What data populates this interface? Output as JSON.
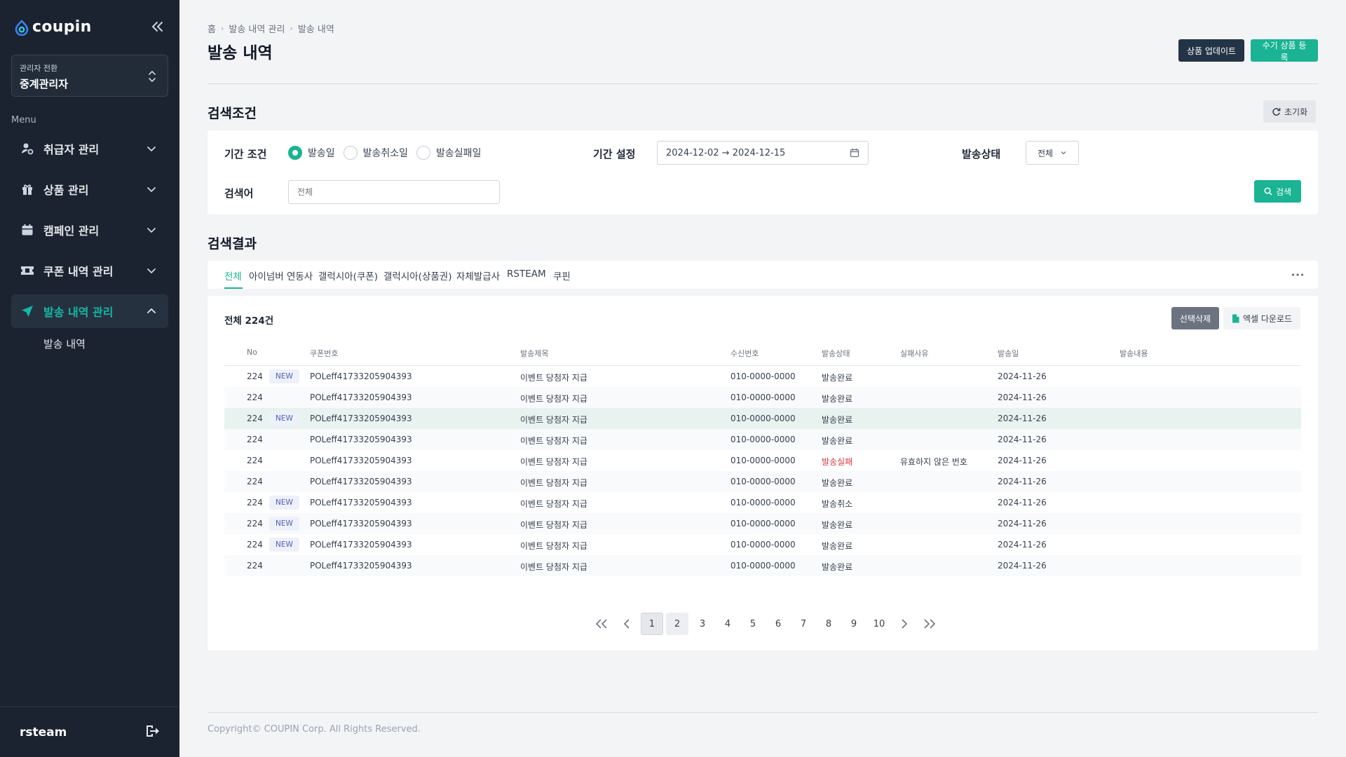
{
  "brand": {
    "name": "coupin",
    "accent": "#1ab394",
    "sidebar_bg": "#1b2330"
  },
  "sidebar": {
    "switcher": {
      "label": "관리자 전환",
      "value": "중계관리자"
    },
    "menu_caption": "Menu",
    "items": [
      {
        "label": "취급자 관리",
        "icon": "user-gear-icon"
      },
      {
        "label": "상품 관리",
        "icon": "gift-icon"
      },
      {
        "label": "캠페인 관리",
        "icon": "calendar-icon"
      },
      {
        "label": "쿠폰 내역 관리",
        "icon": "ticket-icon"
      },
      {
        "label": "발송 내역 관리",
        "icon": "send-icon",
        "active": true
      }
    ],
    "sub_item": "발송 내역",
    "user": "rsteam"
  },
  "header": {
    "breadcrumb": [
      "홈",
      "발송 내역 관리",
      "발송 내역"
    ],
    "title": "발송 내역",
    "update_button": "상품 업데이트",
    "register_button": "수기 상품 등록"
  },
  "search": {
    "title": "검색조건",
    "reset_button": "초기화",
    "period_condition_label": "기간 조건",
    "radios": [
      {
        "label": "발송일",
        "checked": true
      },
      {
        "label": "발송취소일",
        "checked": false
      },
      {
        "label": "발송실패일",
        "checked": false
      }
    ],
    "period_label": "기간 설정",
    "period_value": "2024-12-02 → 2024-12-15",
    "status_label": "발송상태",
    "status_value": "전체",
    "keyword_label": "검색어",
    "keyword_placeholder": "전체",
    "search_button": "검색"
  },
  "results": {
    "title": "검색결과",
    "tabs": [
      "전체",
      "아이넘버 연동사",
      "갤럭시아(쿠폰)",
      "갤럭시아(상품권)",
      "자체발급사",
      "RSTEAM",
      "쿠핀"
    ],
    "active_tab": "전체",
    "total": "전체 224건",
    "delete_button": "선택삭제",
    "excel_button": "엑셀 다운로드",
    "columns": [
      "No",
      "쿠폰번호",
      "발송제목",
      "수신번호",
      "발송상태",
      "실패사유",
      "발송일",
      "발송내용"
    ],
    "rows": [
      {
        "no": "224",
        "new": "NEW",
        "coupon": "POLeff41733205904393",
        "title": "이벤트 당첨자 지급",
        "phone": "010-0000-0000",
        "status": "발송완료",
        "reason": "",
        "date": "2024-11-26",
        "content": ""
      },
      {
        "no": "224",
        "new": "",
        "coupon": "POLeff41733205904393",
        "title": "이벤트 당첨자 지급",
        "phone": "010-0000-0000",
        "status": "발송완료",
        "reason": "",
        "date": "2024-11-26",
        "content": ""
      },
      {
        "no": "224",
        "new": "NEW",
        "coupon": "POLeff41733205904393",
        "title": "이벤트 당첨자 지급",
        "phone": "010-0000-0000",
        "status": "발송완료",
        "reason": "",
        "date": "2024-11-26",
        "content": ""
      },
      {
        "no": "224",
        "new": "",
        "coupon": "POLeff41733205904393",
        "title": "이벤트 당첨자 지급",
        "phone": "010-0000-0000",
        "status": "발송완료",
        "reason": "",
        "date": "2024-11-26",
        "content": ""
      },
      {
        "no": "224",
        "new": "",
        "coupon": "POLeff41733205904393",
        "title": "이벤트 당첨자 지급",
        "phone": "010-0000-0000",
        "status": "발송실패",
        "reason": "유효하지 않은 번호",
        "date": "2024-11-26",
        "content": ""
      },
      {
        "no": "224",
        "new": "",
        "coupon": "POLeff41733205904393",
        "title": "이벤트 당첨자 지급",
        "phone": "010-0000-0000",
        "status": "발송완료",
        "reason": "",
        "date": "2024-11-26",
        "content": ""
      },
      {
        "no": "224",
        "new": "NEW",
        "coupon": "POLeff41733205904393",
        "title": "이벤트 당첨자 지급",
        "phone": "010-0000-0000",
        "status": "발송취소",
        "reason": "",
        "date": "2024-11-26",
        "content": ""
      },
      {
        "no": "224",
        "new": "NEW",
        "coupon": "POLeff41733205904393",
        "title": "이벤트 당첨자 지급",
        "phone": "010-0000-0000",
        "status": "발송완료",
        "reason": "",
        "date": "2024-11-26",
        "content": ""
      },
      {
        "no": "224",
        "new": "NEW",
        "coupon": "POLeff41733205904393",
        "title": "이벤트 당첨자 지급",
        "phone": "010-0000-0000",
        "status": "발송완료",
        "reason": "",
        "date": "2024-11-26",
        "content": ""
      },
      {
        "no": "224",
        "new": "",
        "coupon": "POLeff41733205904393",
        "title": "이벤트 당첨자 지급",
        "phone": "010-0000-0000",
        "status": "발송완료",
        "reason": "",
        "date": "2024-11-26",
        "content": ""
      }
    ],
    "pagination": {
      "pages": [
        "1",
        "2",
        "3",
        "4",
        "5",
        "6",
        "7",
        "8",
        "9",
        "10"
      ],
      "current": "1"
    }
  },
  "footer": {
    "copyright": "Copyright© COUPIN Corp. All Rights Reserved."
  }
}
